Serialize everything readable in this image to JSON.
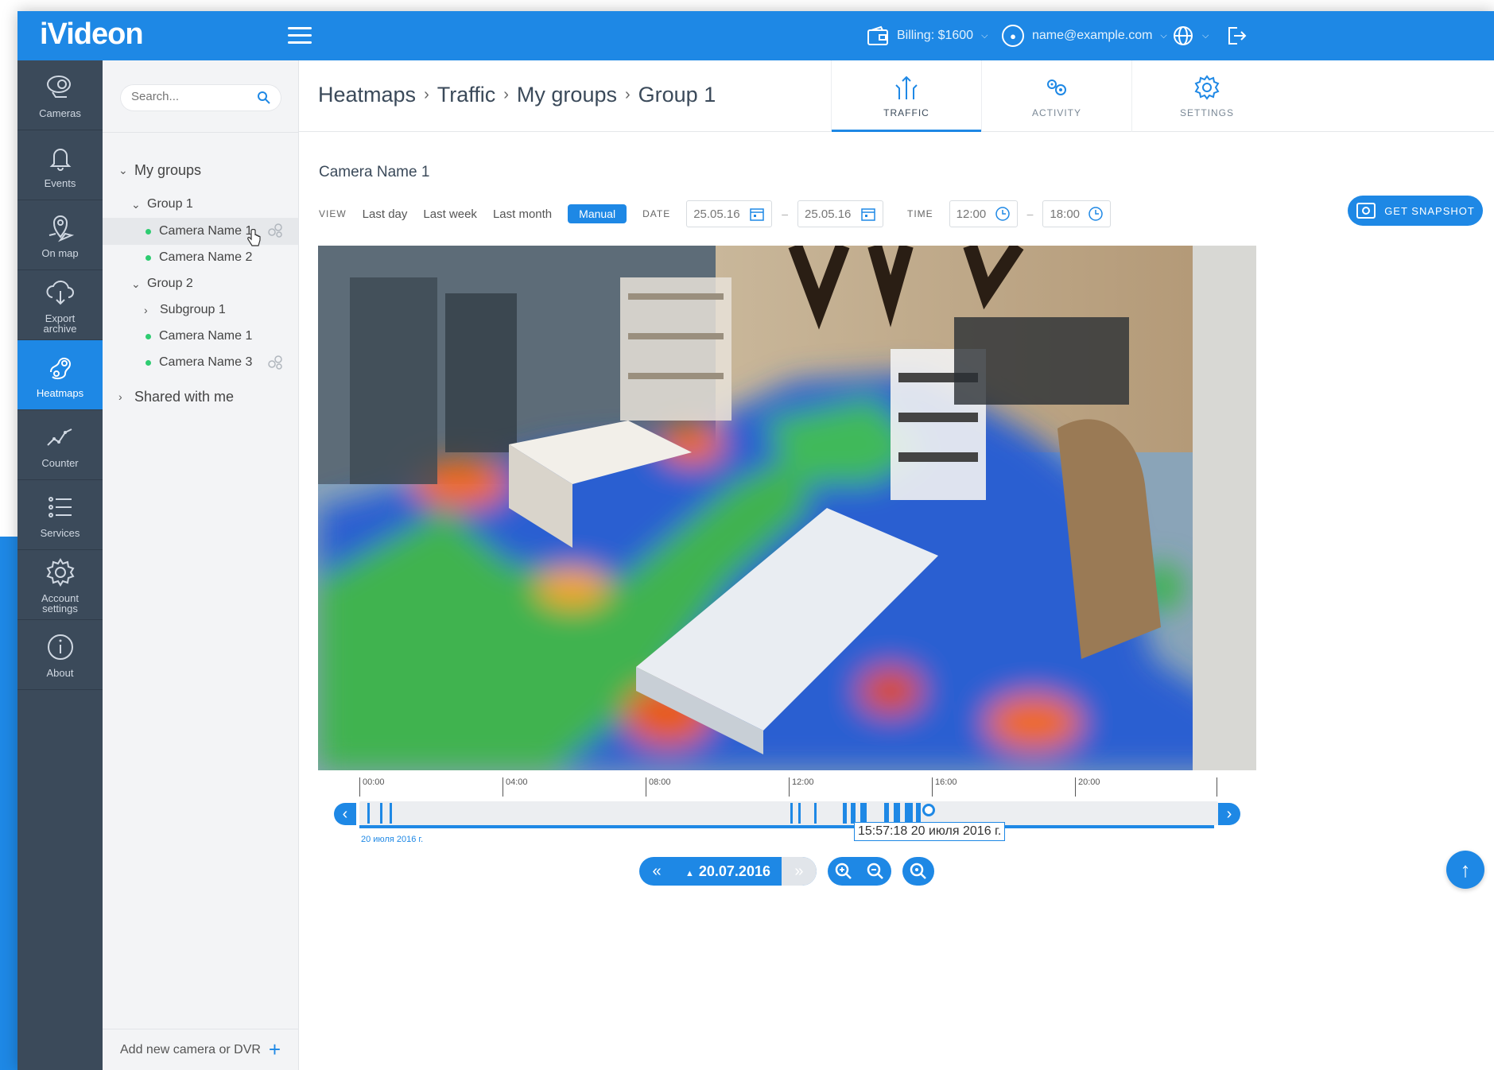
{
  "app": {
    "logo": "iVideon"
  },
  "topbar": {
    "billing": "Billing: $1600",
    "account": "name@example.com"
  },
  "sidebar": {
    "items": [
      {
        "label": "Cameras",
        "icon": "camera-icon"
      },
      {
        "label": "Events",
        "icon": "bell-icon"
      },
      {
        "label": "On map",
        "icon": "map-pin-icon"
      },
      {
        "label": "Export archive",
        "icon": "cloud-download-icon"
      },
      {
        "label": "Heatmaps",
        "icon": "heatmap-icon",
        "active": true
      },
      {
        "label": "Counter",
        "icon": "line-chart-icon"
      },
      {
        "label": "Services",
        "icon": "list-icon"
      },
      {
        "label": "Account settings",
        "icon": "gear-icon"
      },
      {
        "label": "About",
        "icon": "info-icon"
      }
    ]
  },
  "tree": {
    "search_placeholder": "Search...",
    "my_groups": "My groups",
    "group1": "Group 1",
    "group1_cam1": "Camera Name 1",
    "group1_cam2": "Camera Name 2",
    "group2": "Group 2",
    "subgroup1": "Subgroup 1",
    "group2_cam1": "Camera Name 1",
    "group2_cam3": "Camera Name 3",
    "shared": "Shared with me",
    "add_camera": "Add new camera or DVR"
  },
  "breadcrumb": [
    "Heatmaps",
    "Traffic",
    "My groups",
    "Group 1"
  ],
  "tabs": [
    {
      "label": "TRAFFIC",
      "icon": "traffic-icon",
      "active": true
    },
    {
      "label": "ACTIVITY",
      "icon": "activity-icon"
    },
    {
      "label": "SETTINGS",
      "icon": "settings-icon"
    }
  ],
  "camera_title": "Camera Name 1",
  "filters": {
    "view_label": "VIEW",
    "options": [
      "Last day",
      "Last week",
      "Last month",
      "Manual"
    ],
    "selected": "Manual",
    "date_label": "DATE",
    "date_from": "25.05.16",
    "date_to": "25.05.16",
    "time_label": "TIME",
    "time_from": "12:00",
    "time_to": "18:00",
    "snapshot_button": "GET SNAPSHOT"
  },
  "timeline": {
    "ticks": [
      "00:00",
      "04:00",
      "08:00",
      "12:00",
      "16:00",
      "20:00"
    ],
    "timestamp": "15:57:18 20 июля 2016 г.",
    "date_small": "20 июля 2016 г.",
    "player_date": "20.07.2016"
  },
  "colors": {
    "accent": "#1e88e5",
    "sidebar": "#3b4a5a",
    "recording": "#2ecc71"
  }
}
